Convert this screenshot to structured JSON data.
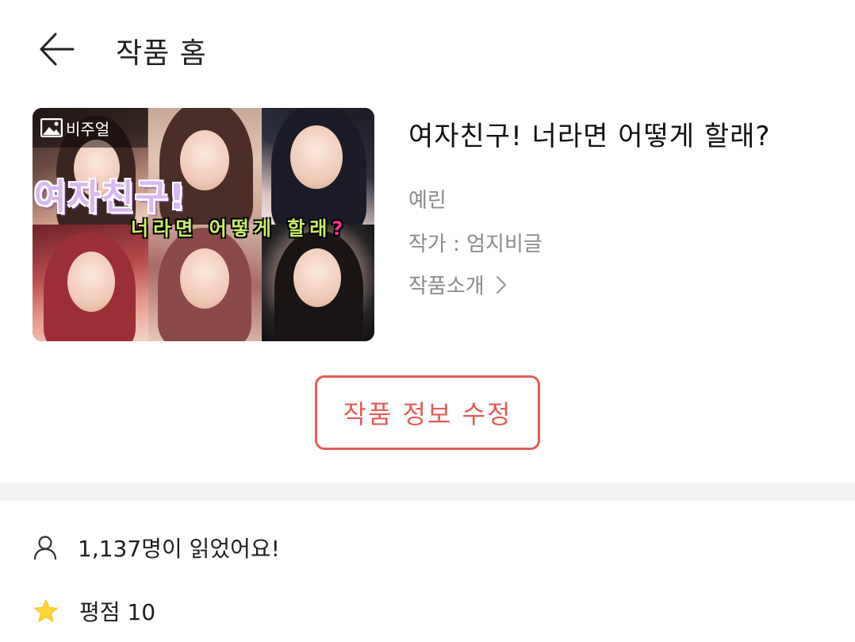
{
  "header": {
    "title": "작품 홈"
  },
  "visual_badge": {
    "label": "비주얼",
    "icon": "image-icon"
  },
  "cover": {
    "title_text": "여자친구!",
    "subtitle_text": "너라면 어떻게 할래",
    "subtitle_mark": "?"
  },
  "work": {
    "title": "여자친구! 너라면 어떻게 할래?",
    "author": "예린",
    "writer": "작가 : 엄지비글",
    "intro_label": "작품소개"
  },
  "edit_button": {
    "label": "작품 정보 수정"
  },
  "stats": {
    "readers": "1,137명이 읽었어요!",
    "rating": "평점 10"
  },
  "colors": {
    "accent": "#e45b58",
    "muted_text": "#8a8a8a",
    "divider": "#f1f3f5",
    "star": "#fcd535"
  }
}
